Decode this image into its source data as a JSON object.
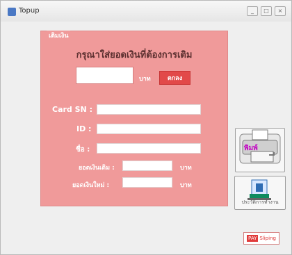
{
  "window": {
    "title": "Topup",
    "buttons": [
      "_",
      "□",
      "×"
    ]
  },
  "group": {
    "label": "เติมเงิน",
    "heading": "กรุณาใส่ยอดเงินที่ต้องการเติม",
    "amount_input": {
      "value": "",
      "placeholder": ""
    },
    "baht_label": "บาท",
    "ok_button": "ตกลง",
    "card_sn_label": "Card SN :",
    "id_label": "ID :",
    "name_label": "ชื่อ :",
    "old_balance_label": "ยอดเงินเดิม :",
    "new_balance_label": "ยอดเงินใหม่ :",
    "old_balance_unit": "บาท",
    "new_balance_unit": "บาท"
  },
  "actions": {
    "print_icon": "printer-icon",
    "history_label": "ประวัติการทำงาน"
  },
  "brand": {
    "logo_left": "PAY",
    "logo_right": "Sliping"
  }
}
